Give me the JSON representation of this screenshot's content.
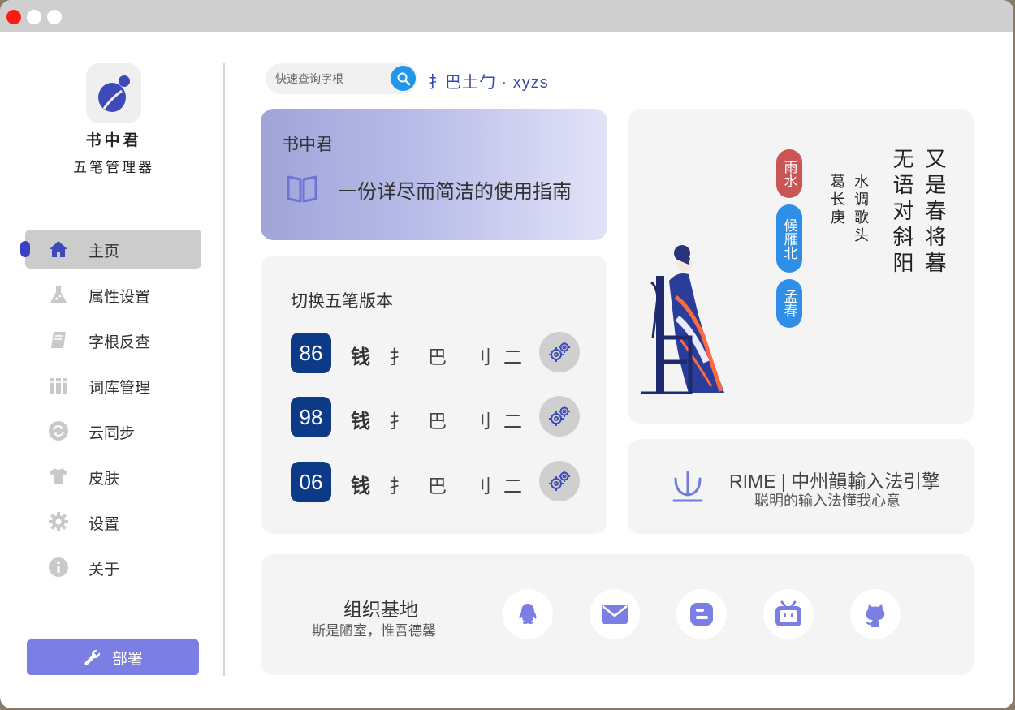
{
  "app": {
    "name": "书中君",
    "subtitle": "五笔管理器"
  },
  "sidebar": {
    "items": [
      {
        "label": "主页",
        "icon": "home-icon",
        "active": true
      },
      {
        "label": "属性设置",
        "icon": "flask-icon"
      },
      {
        "label": "字根反查",
        "icon": "book-icon"
      },
      {
        "label": "词库管理",
        "icon": "library-icon"
      },
      {
        "label": "云同步",
        "icon": "sync-icon"
      },
      {
        "label": "皮肤",
        "icon": "shirt-icon"
      },
      {
        "label": "设置",
        "icon": "gear-icon"
      },
      {
        "label": "关于",
        "icon": "info-icon"
      }
    ],
    "deploy_label": "部署"
  },
  "search": {
    "placeholder": "快速查询字根",
    "result": "扌巴土勹 · xyzs"
  },
  "guide": {
    "title": "书中君",
    "text": "一份详尽而简洁的使用指南"
  },
  "versions": {
    "title": "切换五笔版本",
    "rows": [
      {
        "version": "86",
        "char": "钱",
        "roots": [
          "扌",
          "巴",
          "刂",
          "二"
        ]
      },
      {
        "version": "98",
        "char": "钱",
        "roots": [
          "扌",
          "巴",
          "刂",
          "二"
        ]
      },
      {
        "version": "06",
        "char": "钱",
        "roots": [
          "扌",
          "巴",
          "刂",
          "二"
        ]
      }
    ]
  },
  "poem": {
    "col1": "又是春将暮",
    "col2": "无语对斜阳",
    "col3": "水调歌头",
    "col4": "葛长庚",
    "seals": [
      "雨水",
      "候雁北",
      "孟春"
    ]
  },
  "rime": {
    "title": "RIME | 中州韻輸入法引擎",
    "subtitle": "聪明的输入法懂我心意"
  },
  "org": {
    "title": "组织基地",
    "subtitle": "斯是陋室，惟吾德馨",
    "links": [
      "qq-icon",
      "mail-icon",
      "blogger-icon",
      "bilibili-icon",
      "github-icon"
    ]
  },
  "colors": {
    "accent": "#7b7fe3",
    "badge": "#0d3a87",
    "search_button": "#2296ea",
    "seal_red": "#c95555",
    "seal_blue": "#2f8fe6"
  }
}
